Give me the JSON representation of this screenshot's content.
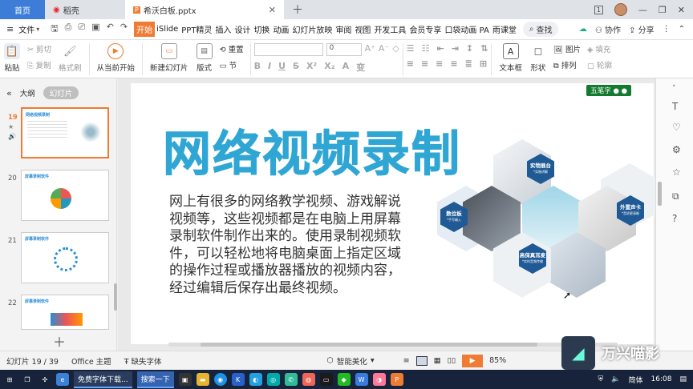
{
  "tabs": {
    "home": "首页",
    "daoke": "稻壳",
    "doc": "希沃白板.pptx",
    "badge": "1"
  },
  "menu": {
    "file": "文件",
    "items": [
      "开始",
      "iSlide",
      "PPT精灵",
      "插入",
      "设计",
      "切换",
      "动画",
      "幻灯片放映",
      "审阅",
      "视图",
      "开发工具",
      "会员专享",
      "口袋动画 PA",
      "雨课堂"
    ],
    "search": "查找",
    "collab": "协作",
    "share": "分享"
  },
  "ribbon": {
    "paste": "粘贴",
    "cut": "剪切",
    "copy": "复制",
    "format_painter": "格式刷",
    "from_current": "从当前开始",
    "new_slide": "新建幻灯片",
    "layout": "版式",
    "section": "节",
    "reset": "重置",
    "font_size": "0",
    "textbox": "文本框",
    "shape": "形状",
    "arrange": "排列",
    "picture": "图片",
    "fill": "填充",
    "outline": "轮廓"
  },
  "sidebar": {
    "tab_outline": "大纲",
    "tab_slides": "幻灯片",
    "thumbs": [
      {
        "num": "19",
        "title": "网络视频录制"
      },
      {
        "num": "20",
        "title": "屏幕录制软件"
      },
      {
        "num": "21",
        "title": "屏幕录制软件"
      },
      {
        "num": "22",
        "title": "屏幕录制软件"
      }
    ]
  },
  "slide": {
    "title": "网络视频录制",
    "body": "网上有很多的网络教学视频、游戏解说视频等，这些视频都是在电脑上用屏幕录制软件制作出来的。使用录制视频软件，可以轻松地将电脑桌面上指定区域的操作过程或播放器播放的视频内容，经过编辑后保存出最终视频。",
    "wubi": "五笔字",
    "labels": [
      {
        "title": "实物展台",
        "sub": "*实物讲解"
      },
      {
        "title": "数位板",
        "sub": "*手写输入"
      },
      {
        "title": "外置声卡",
        "sub": "*音质更清晰"
      },
      {
        "title": "高保真耳麦",
        "sub": "*实时音频传输"
      }
    ]
  },
  "status": {
    "slide_counter": "幻灯片 19 / 39",
    "theme": "Office 主题",
    "missing_font": "缺失字体",
    "smart_beautify": "智能美化",
    "zoom": "85%"
  },
  "taskbar": {
    "item1": "免费字体下载...",
    "item2": "搜索一下",
    "ime": "简体",
    "time": "16:08"
  },
  "watermark": {
    "brand": "万兴喵影"
  },
  "colors": {
    "accent": "#f07c34",
    "title": "#2fa6d4",
    "hex_label": "#1f5a95"
  }
}
